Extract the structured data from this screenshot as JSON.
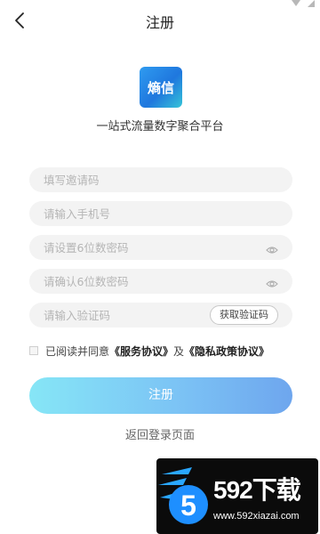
{
  "header": {
    "title": "注册"
  },
  "app": {
    "logo_text": "熵信",
    "slogan": "一站式流量数字聚合平台"
  },
  "form": {
    "invite_placeholder": "填写邀请码",
    "phone_placeholder": "请输入手机号",
    "password_placeholder": "请设置6位数密码",
    "confirm_placeholder": "请确认6位数密码",
    "code_placeholder": "请输入验证码",
    "get_code_label": "获取验证码"
  },
  "agreement": {
    "prefix": "已阅读并同意",
    "service": "《服务协议》",
    "and": "及",
    "privacy": "《隐私政策协议》"
  },
  "actions": {
    "register_label": "注册",
    "back_login_label": "返回登录页面"
  },
  "watermark": {
    "brand": "592下载",
    "url": "www.592xiazai.com"
  },
  "icons": {
    "back": "chevron-left-icon",
    "eye": "eye-icon",
    "wifi": "wifi-icon",
    "signal": "signal-icon"
  },
  "colors": {
    "button_start": "#86e6f6",
    "button_end": "#6ea6ee",
    "logo": "#1f77de"
  }
}
